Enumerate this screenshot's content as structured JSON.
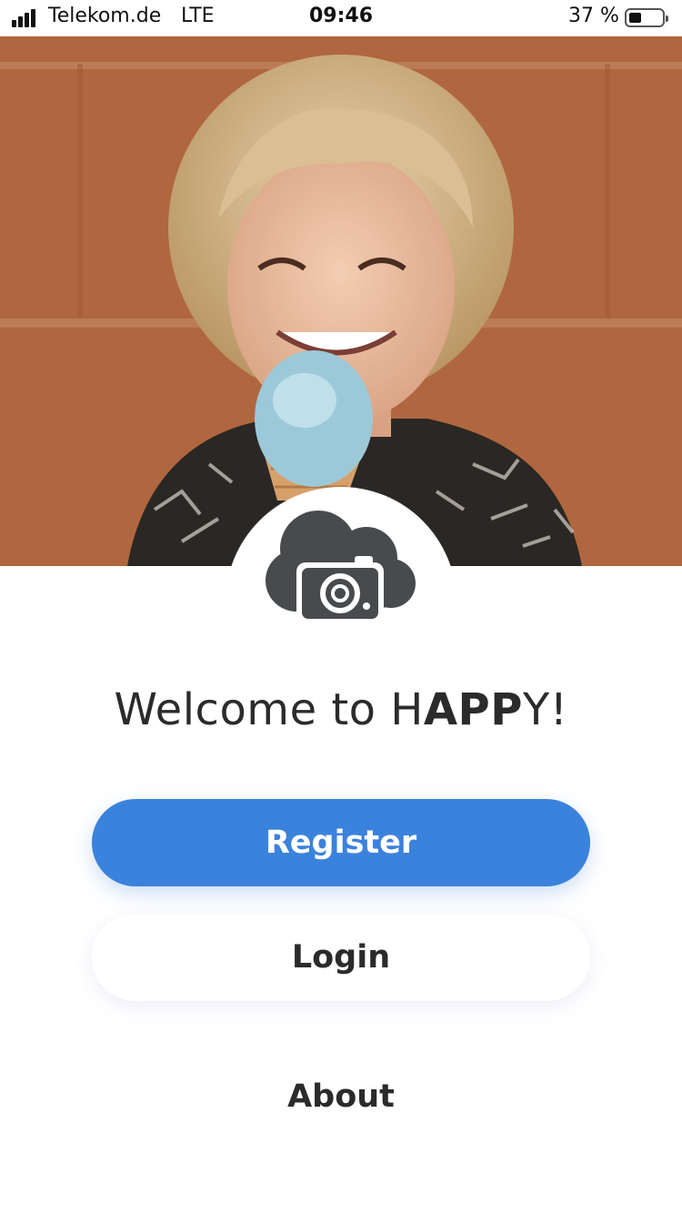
{
  "status_bar": {
    "carrier": "Telekom.de",
    "network": "LTE",
    "time": "09:46",
    "battery_percent": "37 %"
  },
  "hero": {
    "image_description_icon": "photo-hero",
    "badge_icon": "cloud-camera-icon"
  },
  "welcome": {
    "prefix": "Welcome to H",
    "bold": "APP",
    "suffix": "Y!"
  },
  "actions": {
    "register_label": "Register",
    "login_label": "Login",
    "about_label": "About"
  },
  "colors": {
    "primary": "#3b82dc",
    "text": "#2b2b2b",
    "icon": "#474b4e",
    "hero_wall": "#b86b41"
  }
}
